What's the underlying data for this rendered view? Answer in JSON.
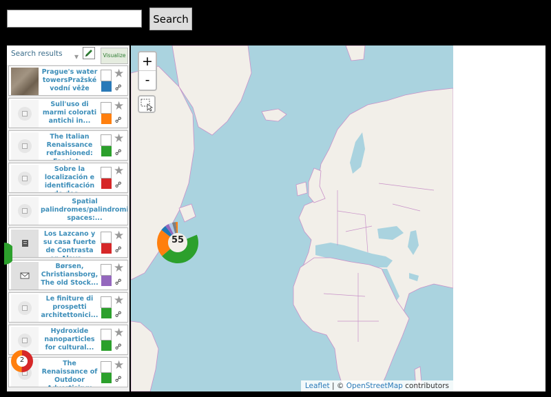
{
  "search": {
    "placeholder": "",
    "button_label": "Search"
  },
  "sidebar": {
    "selector_label": "Search results",
    "visualize_label": "Visualize",
    "items": [
      {
        "title": "Prague's water towersPražské vodní věže",
        "color": "#2a7ab8",
        "thumb": "photo"
      },
      {
        "title": "Sull'uso di marmi colorati antichi in...",
        "color": "#ff7f0e",
        "thumb": "camera"
      },
      {
        "title": "The Italian Renaissance refashioned: Fascist...",
        "color": "#2ca02c",
        "thumb": "camera"
      },
      {
        "title": "Sobre la localización e identificación de dos...",
        "color": "#d62728",
        "thumb": "camera"
      },
      {
        "title": "Spatial palindromes/palindromic spaces:...",
        "color": "",
        "thumb": "camera"
      },
      {
        "title": "Los Lazcano y su casa fuerte de Contrasta en Alava...",
        "color": "#d62728",
        "thumb": "doc"
      },
      {
        "title": "Børsen, Christiansborg, The old Stock...",
        "color": "#9467bd",
        "thumb": "doc"
      },
      {
        "title": "Le finiture di prospetti architettonici...",
        "color": "#2ca02c",
        "thumb": "camera"
      },
      {
        "title": "Hydroxide nanoparticles for cultural...",
        "color": "#2ca02c",
        "thumb": "camera"
      },
      {
        "title": "The Renaissance of Outdoor Advertising: From...",
        "color": "#2ca02c",
        "thumb": "camera"
      }
    ]
  },
  "map": {
    "zoom_in": "+",
    "zoom_out": "-",
    "cluster_count": "55",
    "small_cluster_count": "2",
    "attribution": {
      "leaflet": "Leaflet",
      "sep": " | © ",
      "osm": "OpenStreetMap",
      "suffix": " contributors"
    }
  },
  "colors": {
    "land": "#f2efe9",
    "water": "#aad3df",
    "border": "#c890c8",
    "link": "#3d8eb9"
  }
}
